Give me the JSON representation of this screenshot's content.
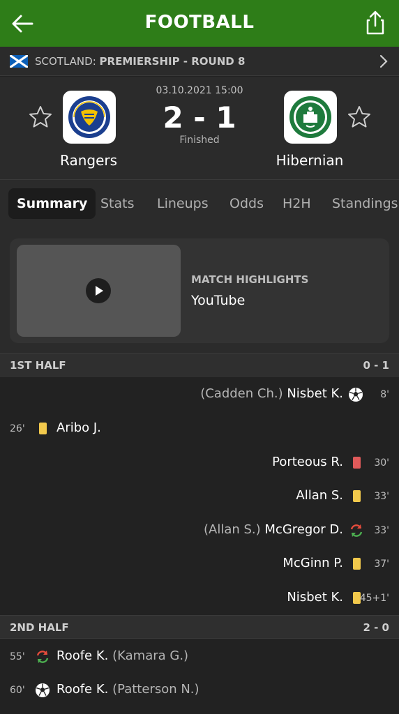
{
  "header": {
    "title": "FOOTBALL"
  },
  "league": {
    "country": "SCOTLAND:",
    "competition": "PREMIERSHIP - ROUND 8"
  },
  "match": {
    "datetime": "03.10.2021 15:00",
    "score": "2 - 1",
    "status": "Finished",
    "home": {
      "name": "Rangers"
    },
    "away": {
      "name": "Hibernian"
    }
  },
  "tabs": [
    "Summary",
    "Stats",
    "Lineups",
    "Odds",
    "H2H",
    "Standings"
  ],
  "highlights": {
    "label": "MATCH HIGHLIGHTS",
    "source": "YouTube"
  },
  "first_half": {
    "label": "1ST HALF",
    "score": "0 - 1",
    "events": [
      {
        "side": "away",
        "minute": "8'",
        "type": "goal",
        "assist": "(Cadden Ch.)",
        "player": "Nisbet K."
      },
      {
        "side": "home",
        "minute": "26'",
        "type": "yellow-card",
        "player": "Aribo J."
      },
      {
        "side": "away",
        "minute": "30'",
        "type": "red-card",
        "player": "Porteous R."
      },
      {
        "side": "away",
        "minute": "33'",
        "type": "yellow-card",
        "player": "Allan S."
      },
      {
        "side": "away",
        "minute": "33'",
        "type": "substitution",
        "assist": "(Allan S.)",
        "player": "McGregor D."
      },
      {
        "side": "away",
        "minute": "37'",
        "type": "yellow-card",
        "player": "McGinn P."
      },
      {
        "side": "away",
        "minute": "45+1'",
        "type": "yellow-card",
        "player": "Nisbet K."
      }
    ]
  },
  "second_half": {
    "label": "2ND HALF",
    "score": "2 - 0",
    "events": [
      {
        "side": "home",
        "minute": "55'",
        "type": "substitution",
        "player": "Roofe K.",
        "assist": "(Kamara G.)"
      },
      {
        "side": "home",
        "minute": "60'",
        "type": "goal",
        "player": "Roofe K.",
        "assist": "(Patterson N.)"
      }
    ]
  },
  "colors": {
    "header_green": "#2e7d18",
    "yellow_card": "#f2c94c",
    "red_card": "#e05a5a",
    "sub_green": "#4caf50",
    "sub_red": "#e74c3c"
  }
}
